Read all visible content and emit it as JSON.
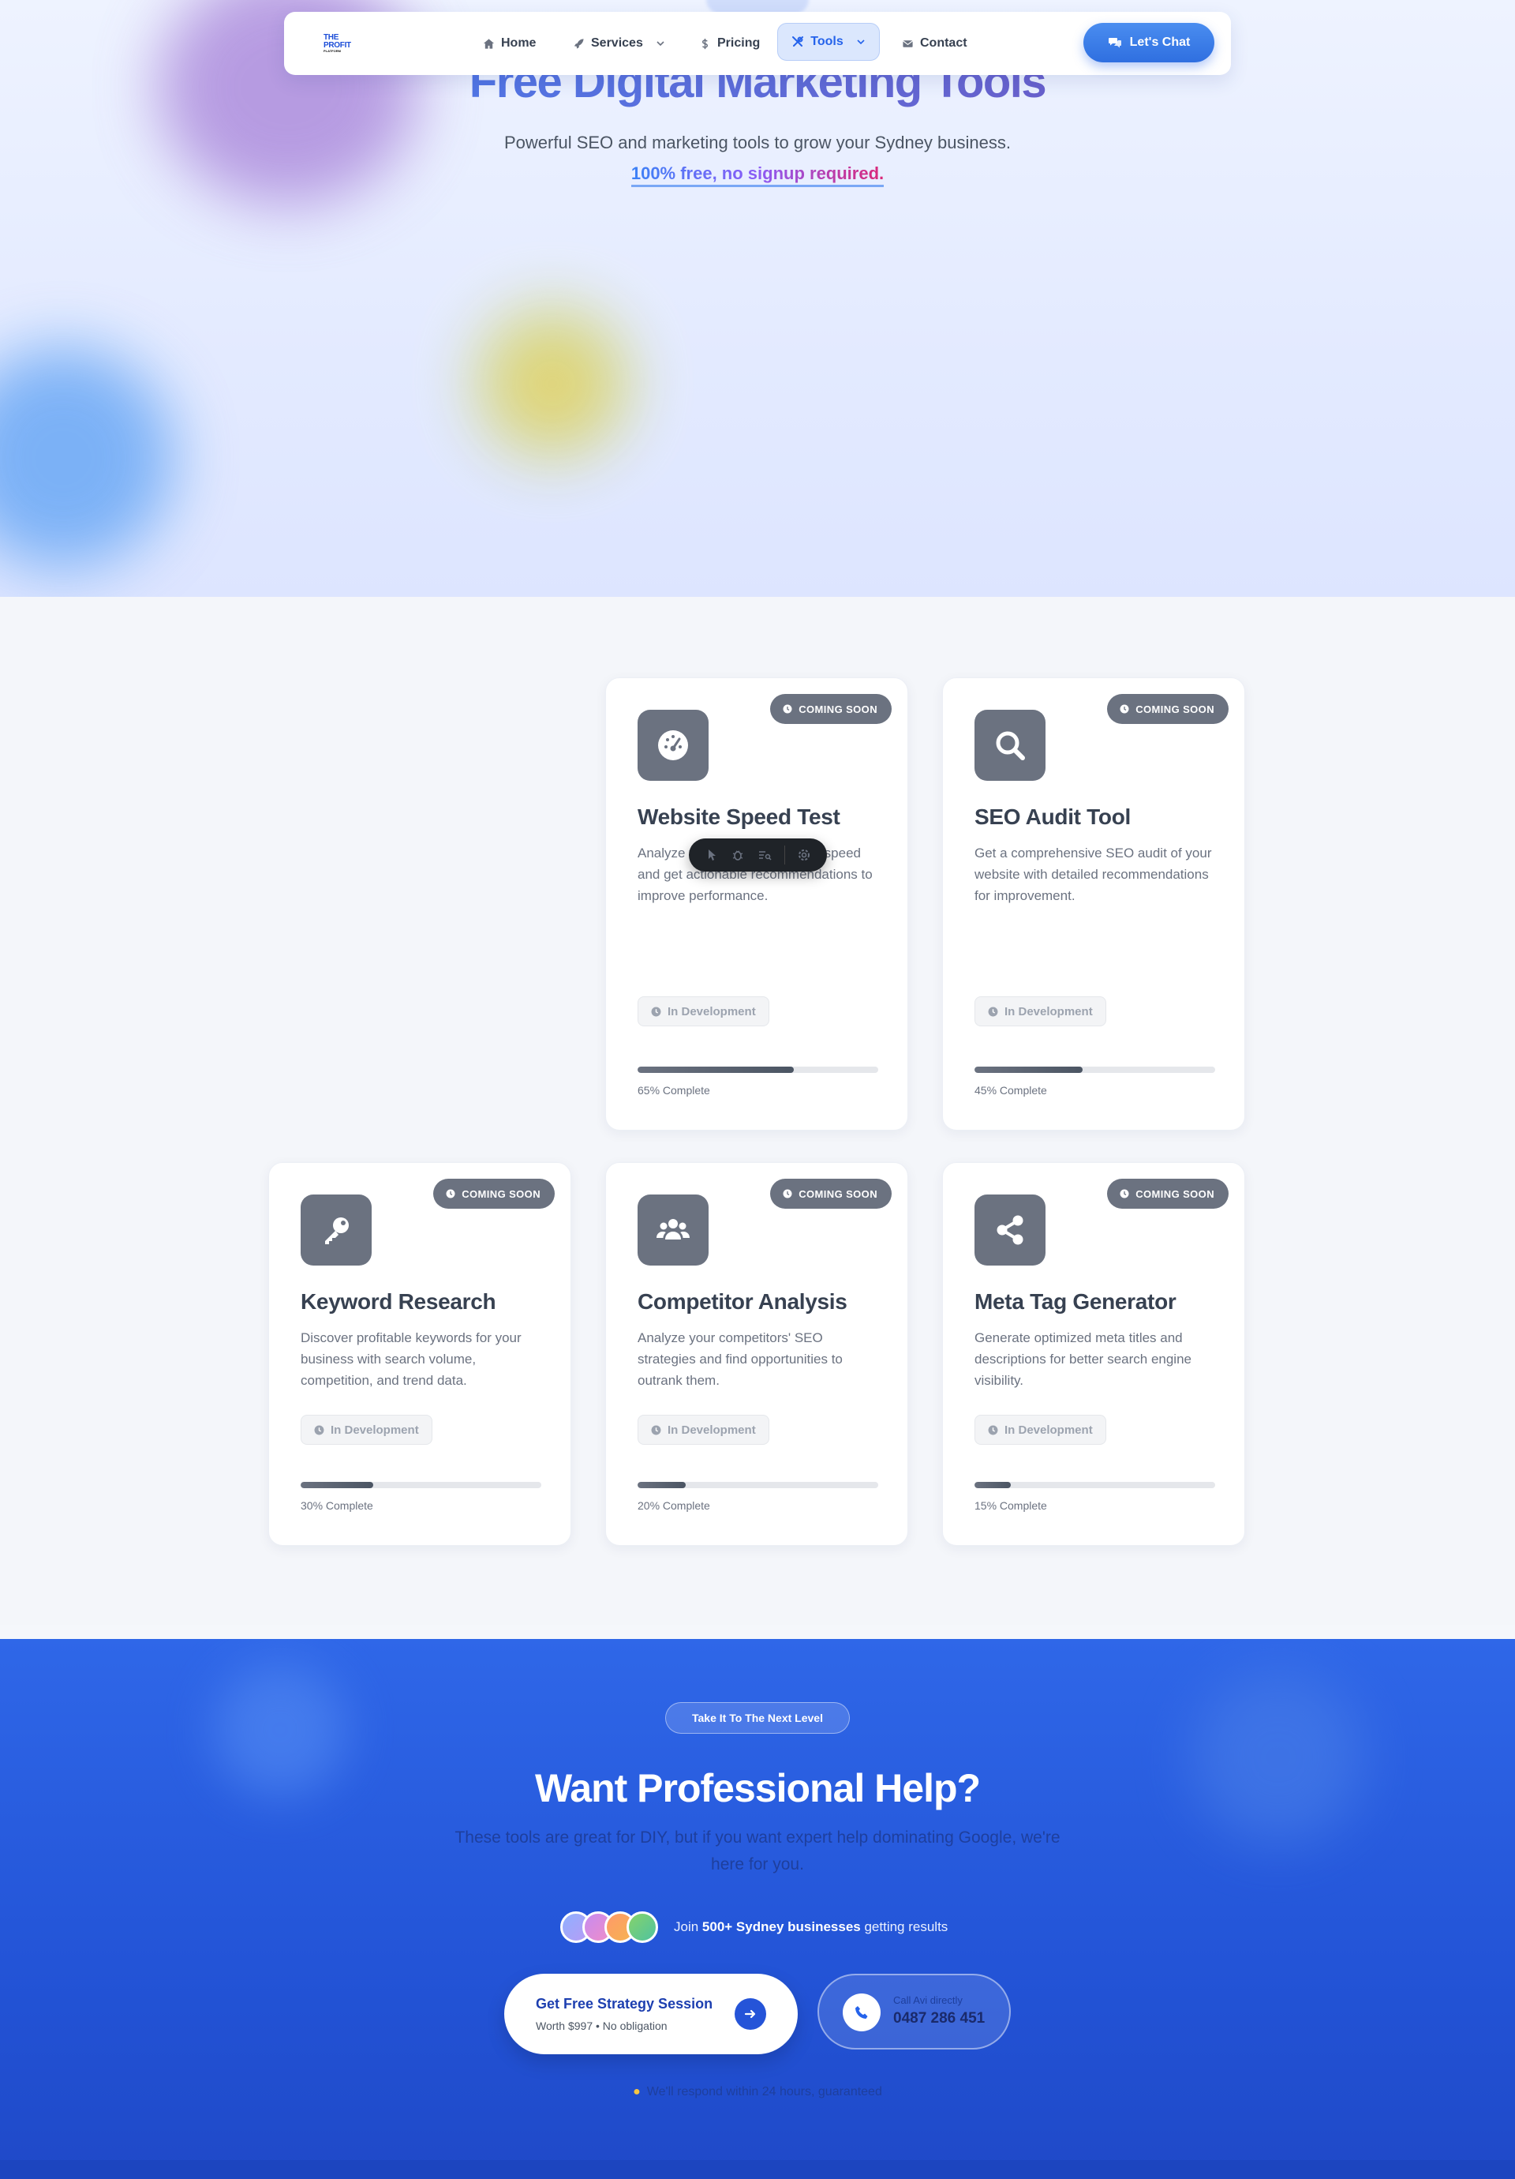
{
  "nav": {
    "logo_line1": "THE",
    "logo_line2": "PROFIT",
    "logo_line3": "PLATFORM",
    "home": "Home",
    "services": "Services",
    "pricing": "Pricing",
    "tools": "Tools",
    "contact": "Contact",
    "chat": "Let's Chat"
  },
  "hero": {
    "title": "Free Digital Marketing Tools",
    "subtitle": "Powerful SEO and marketing tools to grow your Sydney business.",
    "free_note": "100% free, no signup required."
  },
  "cards": [
    {
      "badge": "COMING SOON",
      "icon": "gauge-icon",
      "title": "Website Speed Test",
      "desc": "Analyze your website's loading speed and get actionable recommendations to improve performance.",
      "status": "In Development",
      "progress": 65,
      "progress_label": "65% Complete"
    },
    {
      "badge": "COMING SOON",
      "icon": "search-icon",
      "title": "SEO Audit Tool",
      "desc": "Get a comprehensive SEO audit of your website with detailed recommendations for improvement.",
      "status": "In Development",
      "progress": 45,
      "progress_label": "45% Complete"
    },
    {
      "badge": "COMING SOON",
      "icon": "key-icon",
      "title": "Keyword Research",
      "desc": "Discover profitable keywords for your business with search volume, competition, and trend data.",
      "status": "In Development",
      "progress": 30,
      "progress_label": "30% Complete"
    },
    {
      "badge": "COMING SOON",
      "icon": "users-icon",
      "title": "Competitor Analysis",
      "desc": "Analyze your competitors' SEO strategies and find opportunities to outrank them.",
      "status": "In Development",
      "progress": 20,
      "progress_label": "20% Complete"
    },
    {
      "badge": "COMING SOON",
      "icon": "share-icon",
      "title": "Meta Tag Generator",
      "desc": "Generate optimized meta titles and descriptions for better search engine visibility.",
      "status": "In Development",
      "progress": 15,
      "progress_label": "15% Complete"
    }
  ],
  "cta": {
    "pill": "Take It To The Next Level",
    "title": "Want Professional Help?",
    "text": "These tools are great for DIY, but if you want expert help dominating Google, we're here for you.",
    "social_prefix": "Join ",
    "social_bold": "500+ Sydney businesses",
    "social_suffix": " getting results",
    "strategy_title": "Get Free Strategy Session",
    "strategy_sub": "Worth $997 • No obligation",
    "call_label": "Call Avi directly",
    "call_number": "0487 286 451",
    "promise": "We'll respond within 24 hours, guaranteed"
  },
  "colors": {
    "accent": "#2563eb",
    "card_gray": "#6b7280",
    "cta_blue": "#2354d7"
  }
}
